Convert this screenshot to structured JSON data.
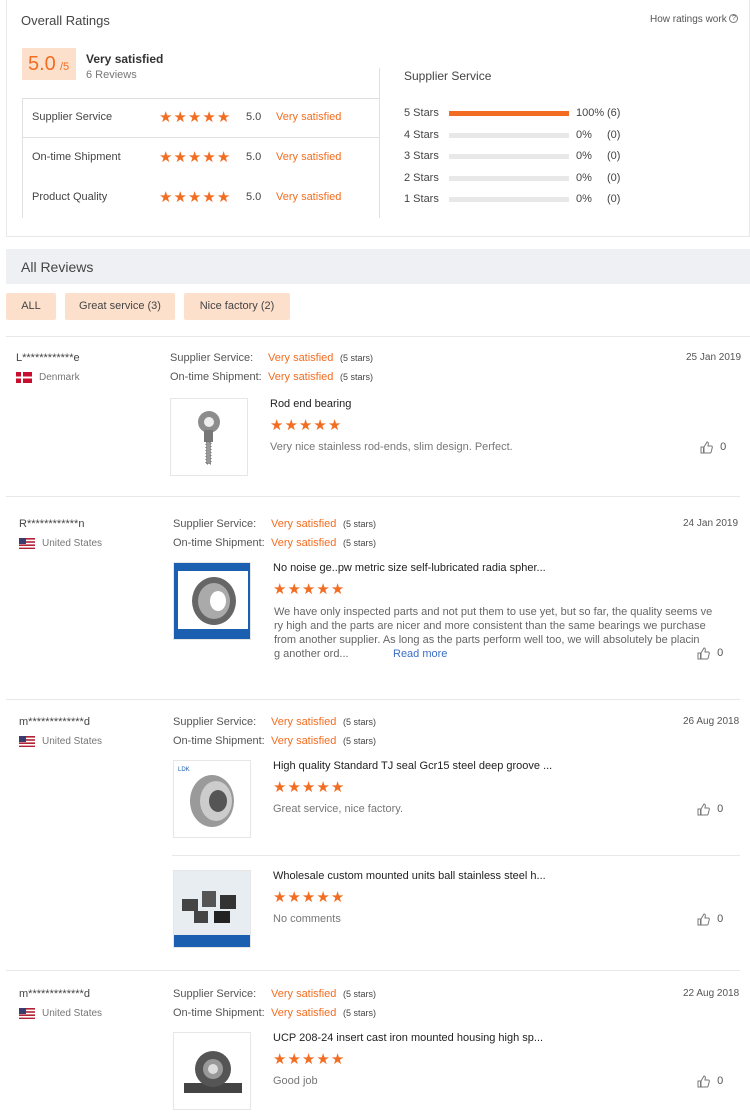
{
  "overall": {
    "title": "Overall Ratings",
    "how_link": "How ratings work",
    "score": "5.0",
    "score_suffix": "/5",
    "summary": "Very satisfied",
    "reviews_count": "6 Reviews",
    "criteria": [
      {
        "label": "Supplier Service",
        "score": "5.0",
        "verdict": "Very satisfied",
        "stars": 5
      },
      {
        "label": "On-time Shipment",
        "score": "5.0",
        "verdict": "Very satisfied",
        "stars": 5
      },
      {
        "label": "Product Quality",
        "score": "5.0",
        "verdict": "Very satisfied",
        "stars": 5
      }
    ]
  },
  "breakdown": {
    "title": "Supplier Service",
    "rows": [
      {
        "label": "5 Stars",
        "pct": "100%",
        "count": "(6)",
        "fraction": 1.0
      },
      {
        "label": "4 Stars",
        "pct": "0%",
        "count": "(0)",
        "fraction": 0
      },
      {
        "label": "3 Stars",
        "pct": "0%",
        "count": "(0)",
        "fraction": 0
      },
      {
        "label": "2 Stars",
        "pct": "0%",
        "count": "(0)",
        "fraction": 0
      },
      {
        "label": "1 Stars",
        "pct": "0%",
        "count": "(0)",
        "fraction": 0
      }
    ]
  },
  "all_reviews": {
    "title": "All Reviews",
    "filters": [
      "ALL",
      "Great service (3)",
      "Nice factory (2)"
    ]
  },
  "labels": {
    "supplier_service": "Supplier Service:",
    "on_time": "On-time Shipment:",
    "five_stars": "(5 stars)",
    "read_more": "Read more"
  },
  "reviews": [
    {
      "user": "L************e",
      "country": "Denmark",
      "date": "25 Jan 2019",
      "supplier": "Very satisfied",
      "shipment": "Very satisfied",
      "items": [
        {
          "product": "Rod end bearing",
          "text": "Very nice stainless rod-ends, slim design. Perfect.",
          "likes": "0",
          "icon": "rod-end-image"
        }
      ]
    },
    {
      "user": "R************n",
      "country": "United States",
      "date": "24 Jan 2019",
      "supplier": "Very satisfied",
      "shipment": "Very satisfied",
      "items": [
        {
          "product": "No noise ge..pw metric size self-lubricated radia spher...",
          "text_lines": [
            "We have only inspected parts and not put them to use yet, but so far, the quality seems ve",
            "ry high and the parts are nicer and more consistent than the same bearings we purchase",
            "from another supplier. As long as the parts perform well too, we will absolutely be placin",
            "g another ord..."
          ],
          "likes": "0",
          "icon": "spherical-bearing-image"
        }
      ]
    },
    {
      "user": "m*************d",
      "country": "United States",
      "date": "26 Aug 2018",
      "supplier": "Very satisfied",
      "shipment": "Very satisfied",
      "items": [
        {
          "product": "High quality Standard TJ seal Gcr15 steel deep groove ...",
          "text": "Great service, nice factory.",
          "likes": "0",
          "icon": "deep-groove-bearing-image"
        },
        {
          "product": "Wholesale custom mounted units ball stainless steel h...",
          "text": "No comments",
          "likes": "0",
          "icon": "mounted-units-image"
        }
      ]
    },
    {
      "user": "m*************d",
      "country": "United States",
      "date": "22 Aug 2018",
      "supplier": "Very satisfied",
      "shipment": "Very satisfied",
      "items": [
        {
          "product": "UCP 208-24 insert cast iron mounted housing high sp...",
          "text": "Good job",
          "likes": "0",
          "icon": "pillow-block-image"
        }
      ]
    }
  ],
  "colors": {
    "accent": "#f26d21",
    "accent_light": "#fde0cc",
    "header_bg": "#eef0f3"
  }
}
